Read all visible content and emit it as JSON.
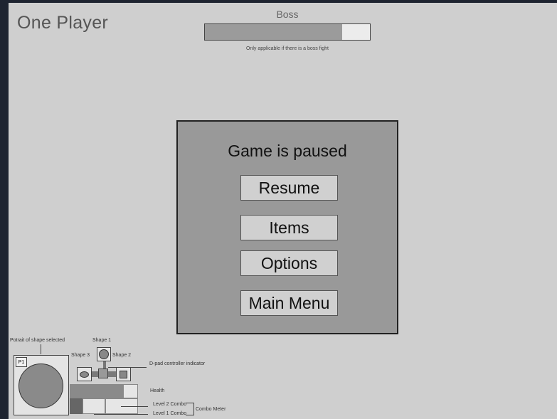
{
  "screen": {
    "title": "One Player"
  },
  "boss": {
    "label": "Boss",
    "health_fraction": 0.83,
    "note": "Only applicable if there is a boss fight"
  },
  "pause_menu": {
    "title": "Game is paused",
    "buttons": [
      {
        "label": "Resume"
      },
      {
        "label": "Items"
      },
      {
        "label": "Options"
      },
      {
        "label": "Main Menu"
      }
    ]
  },
  "hud": {
    "portrait_label": "Potrait of shape selected",
    "player_tag": "P1",
    "shape1_label": "Shape 1",
    "shape2_label": "Shape 2",
    "shape3_label": "Shape 3",
    "dpad_label": "D-pad controller indicator",
    "health_label": "Health",
    "level2_label": "Level 2 Combo",
    "level1_label": "Level 1 Combo",
    "combo_meter_label": "Combo Meter"
  },
  "colors": {
    "background": "#1e2430",
    "canvas": "#cfcfcf",
    "panel": "#999999",
    "button": "#d0d0d0"
  }
}
